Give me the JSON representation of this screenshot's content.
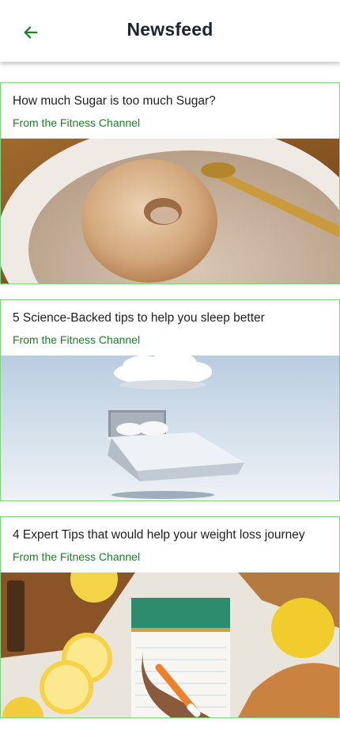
{
  "header": {
    "title": "Newsfeed",
    "back_icon": "arrow-left-icon",
    "accent_color": "#1a7f2a"
  },
  "feed": {
    "cards": [
      {
        "title": "How much Sugar is too much Sugar?",
        "source": "From the Fitness Channel",
        "image": "sugared-donut-bowl-image"
      },
      {
        "title": "5 Science-Backed tips to help you sleep better",
        "source": "From the Fitness Channel",
        "image": "floating-bed-cloud-image"
      },
      {
        "title": "4 Expert Tips that would help your weight loss journey",
        "source": "From the Fitness Channel",
        "image": "lemons-notebook-image"
      }
    ]
  }
}
